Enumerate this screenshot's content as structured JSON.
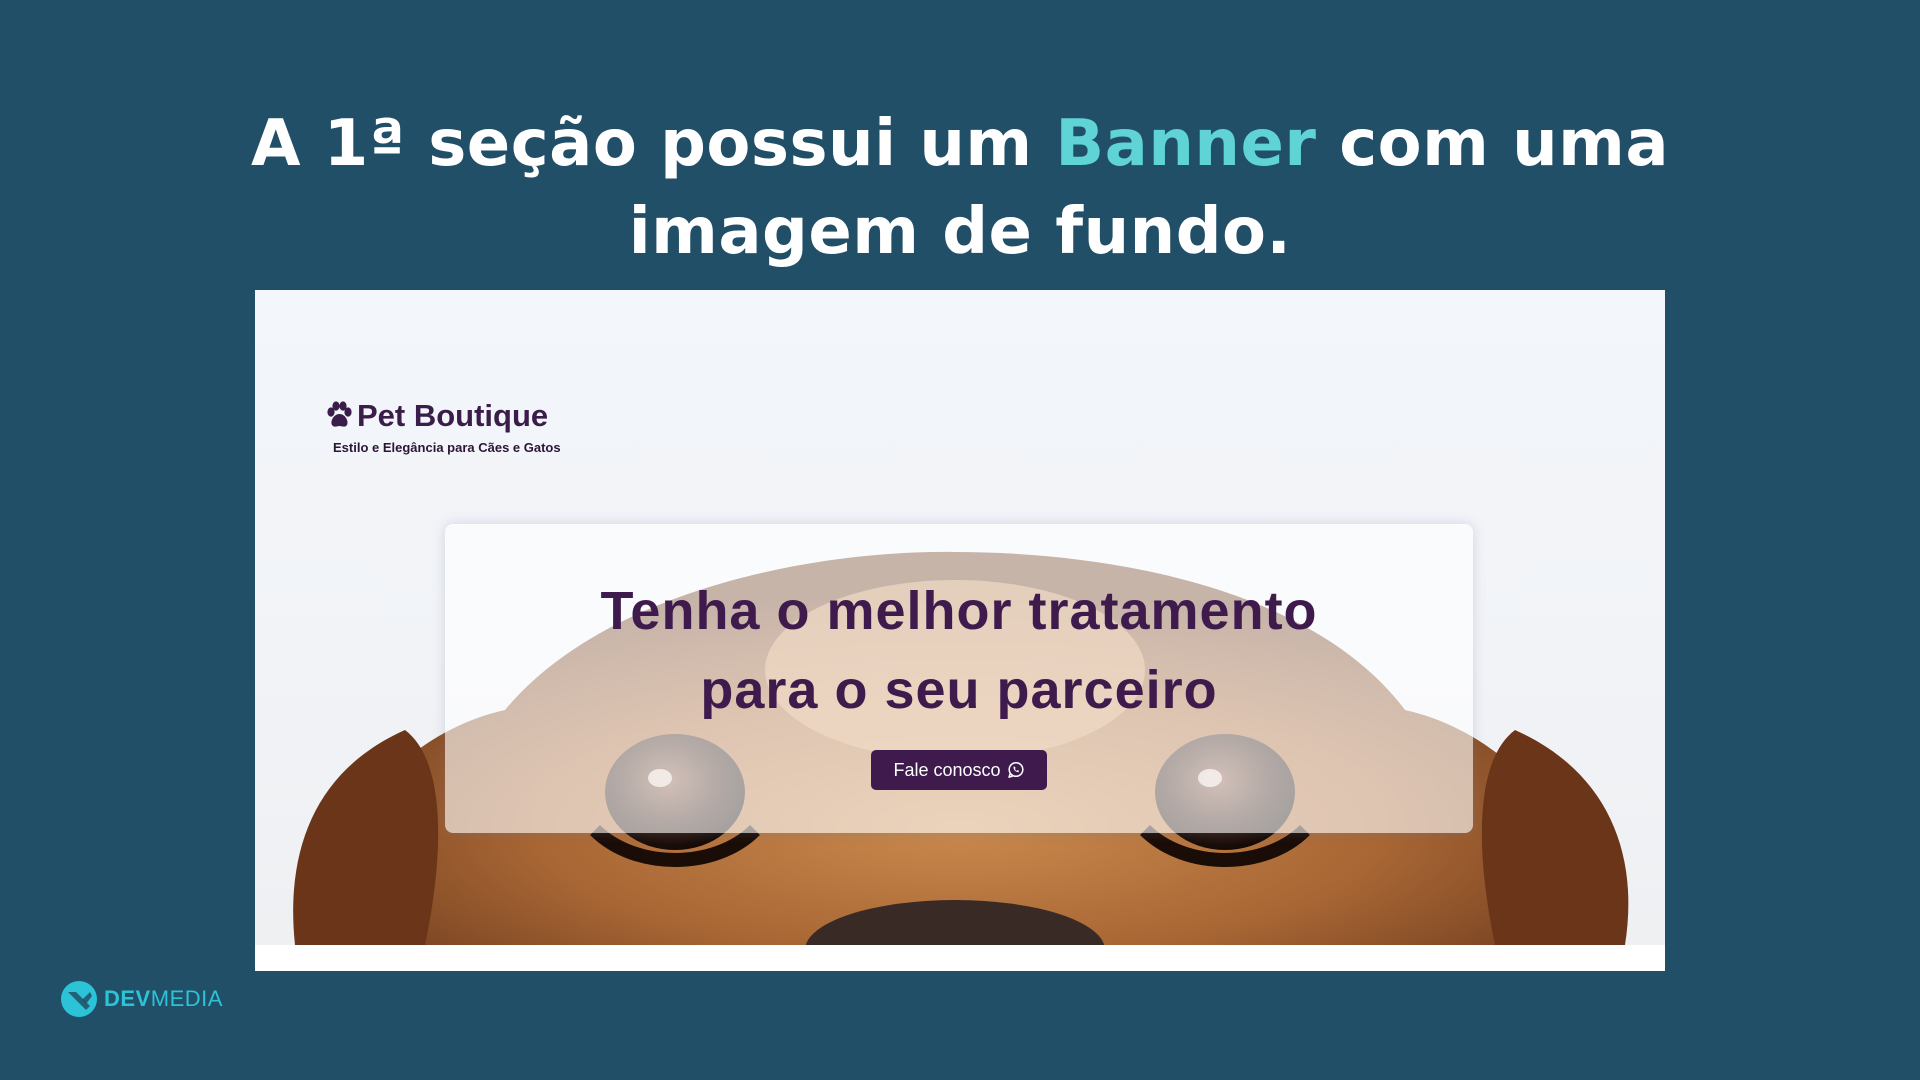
{
  "slide": {
    "title_part1": "A 1ª seção  possui um ",
    "title_highlight": "Banner",
    "title_part2": " com uma",
    "title_line2": "imagem de fundo."
  },
  "site": {
    "brand_name": "Pet Boutique",
    "brand_icon": "paw-icon",
    "tagline": "Estilo e Elegância para Cães e Gatos",
    "hero": {
      "title_line1": "Tenha o melhor tratamento",
      "title_line2": "para o seu parceiro",
      "cta_label": "Fale conosco",
      "cta_icon": "whatsapp-icon"
    }
  },
  "footer_logo": {
    "part1": "DEV",
    "part2": "MEDIA"
  },
  "colors": {
    "background": "#214f67",
    "highlight": "#5fd3d6",
    "brand_purple": "#3e1b4c",
    "devmedia_cyan": "#2cc3d6"
  }
}
